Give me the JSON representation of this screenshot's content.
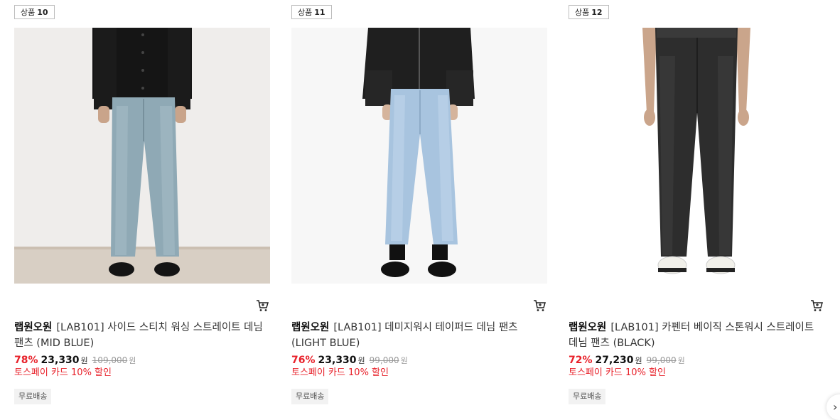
{
  "products": [
    {
      "badge_label": "상품",
      "badge_number": "10",
      "brand": "랩원오원",
      "name": "[LAB101] 사이드 스티치 워싱 스트레이트 데님 팬츠 (MID BLUE)",
      "discount": "78%",
      "price": "23,330",
      "currency": "원",
      "original_price": "109,000",
      "original_currency": "원",
      "promo": "토스페이 카드 10% 할인",
      "shipping": "무료배송",
      "cart_icon": "cart-icon"
    },
    {
      "badge_label": "상품",
      "badge_number": "11",
      "brand": "랩원오원",
      "name": "[LAB101] 데미지워시 테이퍼드 데님 팬츠 (LIGHT BLUE)",
      "discount": "76%",
      "price": "23,330",
      "currency": "원",
      "original_price": "99,000",
      "original_currency": "원",
      "promo": "토스페이 카드 10% 할인",
      "shipping": "무료배송",
      "cart_icon": "cart-icon"
    },
    {
      "badge_label": "상품",
      "badge_number": "12",
      "brand": "랩원오원",
      "name": "[LAB101] 카펜터 베이직 스톤워시 스트레이트 데님 팬츠 (BLACK)",
      "discount": "72%",
      "price": "27,230",
      "currency": "원",
      "original_price": "99,000",
      "original_currency": "원",
      "promo": "토스페이 카드 10% 할인",
      "shipping": "무료배송",
      "cart_icon": "cart-icon"
    }
  ],
  "colors": {
    "discount": "#e8212a",
    "promo": "#e8212a",
    "strike": "#999999"
  }
}
